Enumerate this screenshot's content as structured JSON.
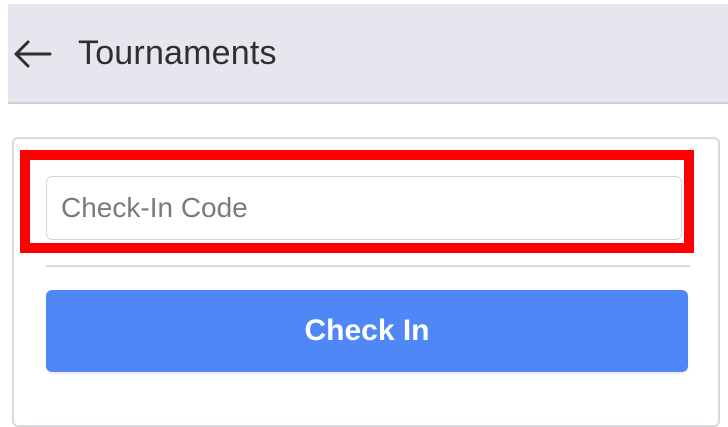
{
  "header": {
    "title": "Tournaments",
    "back_icon": "arrow-left-icon"
  },
  "checkin": {
    "code_placeholder": "Check-In Code",
    "code_value": "",
    "button_label": "Check In"
  },
  "colors": {
    "header_bg": "#e6e6ee",
    "primary": "#4f87f7",
    "highlight": "#ff0000"
  }
}
